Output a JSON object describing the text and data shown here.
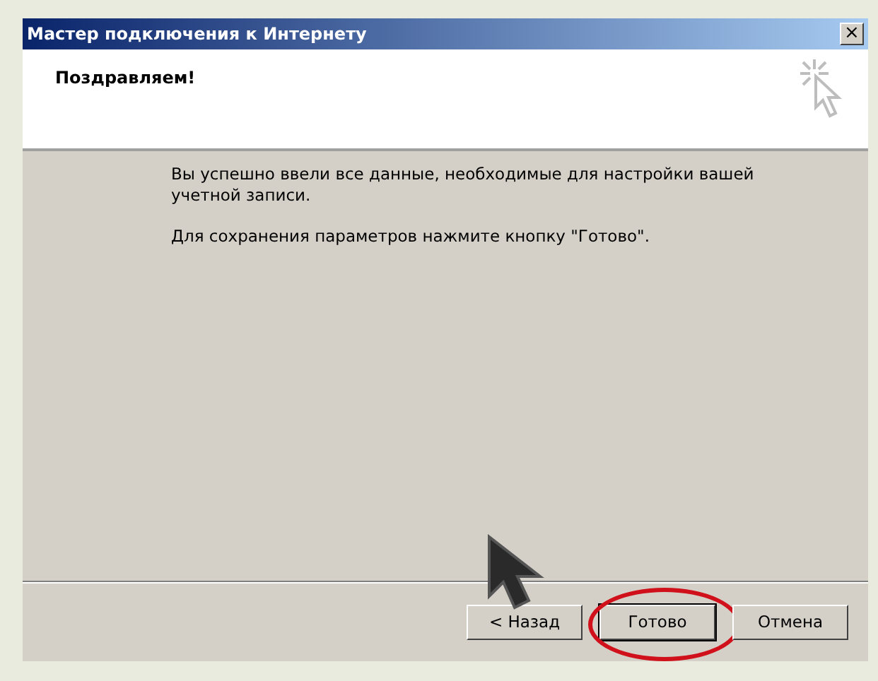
{
  "window": {
    "title": "Мастер подключения к Интернету",
    "close": "×"
  },
  "header": {
    "title": "Поздравляем!"
  },
  "body": {
    "paragraphs": [
      "Вы успешно ввели все данные, необходимые для настройки вашей учетной записи.",
      "Для сохранения параметров нажмите кнопку \"Готово\"."
    ]
  },
  "buttons": [
    {
      "label": "< Назад",
      "default": false,
      "highlighted": false
    },
    {
      "label": "Готово",
      "default": true,
      "highlighted": true
    },
    {
      "label": "Отмена",
      "default": false,
      "highlighted": false
    }
  ]
}
